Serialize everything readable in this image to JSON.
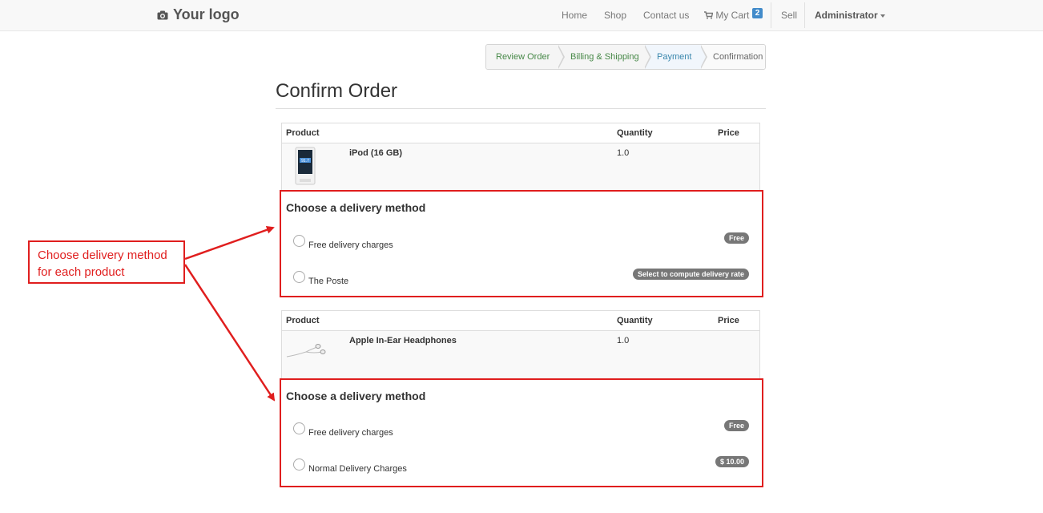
{
  "navbar": {
    "logo_text": "Your logo",
    "links": {
      "home": "Home",
      "shop": "Shop",
      "contact": "Contact us",
      "cart": "My Cart",
      "cart_count": "2",
      "sell": "Sell",
      "user": "Administrator"
    }
  },
  "wizard": {
    "steps": [
      "Review Order",
      "Billing & Shipping",
      "Payment",
      "Confirmation"
    ]
  },
  "page_title": "Confirm Order",
  "orders": [
    {
      "headers": {
        "product": "Product",
        "quantity": "Quantity",
        "price": "Price"
      },
      "product_name": "iPod (16 GB)",
      "quantity": "1.0",
      "delivery": {
        "title": "Choose a delivery method",
        "options": [
          {
            "label": "Free delivery charges",
            "badge": "Free"
          },
          {
            "label": "The Poste",
            "badge": "Select to compute delivery rate"
          }
        ]
      }
    },
    {
      "headers": {
        "product": "Product",
        "quantity": "Quantity",
        "price": "Price"
      },
      "product_name": "Apple In-Ear Headphones",
      "quantity": "1.0",
      "delivery": {
        "title": "Choose a delivery method",
        "options": [
          {
            "label": "Free delivery charges",
            "badge": "Free"
          },
          {
            "label": "Normal Delivery Charges",
            "badge": "$ 10.00"
          }
        ]
      }
    }
  ],
  "callout": {
    "line1": "Choose delivery method",
    "line2": "for each product"
  },
  "colors": {
    "annotation": "#e01e1e",
    "step_done": "#468847",
    "step_active": "#3a87ad",
    "badge_bg": "#777777",
    "cart_badge": "#428bca"
  },
  "icons": [
    "camera-icon",
    "shopping-cart-icon",
    "caret-down-icon",
    "ipod-thumbnail",
    "headphones-thumbnail"
  ]
}
